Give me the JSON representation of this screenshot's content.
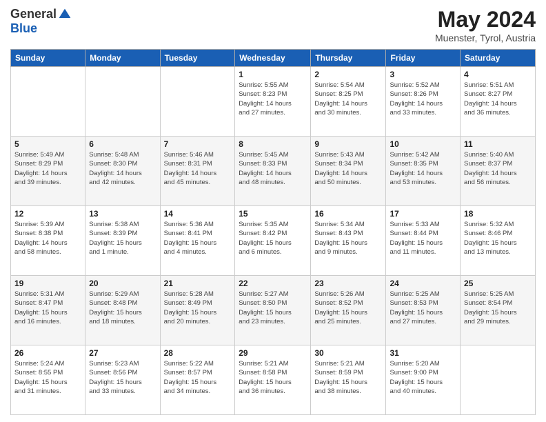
{
  "header": {
    "logo_general": "General",
    "logo_blue": "Blue",
    "month": "May 2024",
    "location": "Muenster, Tyrol, Austria"
  },
  "weekdays": [
    "Sunday",
    "Monday",
    "Tuesday",
    "Wednesday",
    "Thursday",
    "Friday",
    "Saturday"
  ],
  "weeks": [
    [
      {
        "day": "",
        "info": ""
      },
      {
        "day": "",
        "info": ""
      },
      {
        "day": "",
        "info": ""
      },
      {
        "day": "1",
        "info": "Sunrise: 5:55 AM\nSunset: 8:23 PM\nDaylight: 14 hours\nand 27 minutes."
      },
      {
        "day": "2",
        "info": "Sunrise: 5:54 AM\nSunset: 8:25 PM\nDaylight: 14 hours\nand 30 minutes."
      },
      {
        "day": "3",
        "info": "Sunrise: 5:52 AM\nSunset: 8:26 PM\nDaylight: 14 hours\nand 33 minutes."
      },
      {
        "day": "4",
        "info": "Sunrise: 5:51 AM\nSunset: 8:27 PM\nDaylight: 14 hours\nand 36 minutes."
      }
    ],
    [
      {
        "day": "5",
        "info": "Sunrise: 5:49 AM\nSunset: 8:29 PM\nDaylight: 14 hours\nand 39 minutes."
      },
      {
        "day": "6",
        "info": "Sunrise: 5:48 AM\nSunset: 8:30 PM\nDaylight: 14 hours\nand 42 minutes."
      },
      {
        "day": "7",
        "info": "Sunrise: 5:46 AM\nSunset: 8:31 PM\nDaylight: 14 hours\nand 45 minutes."
      },
      {
        "day": "8",
        "info": "Sunrise: 5:45 AM\nSunset: 8:33 PM\nDaylight: 14 hours\nand 48 minutes."
      },
      {
        "day": "9",
        "info": "Sunrise: 5:43 AM\nSunset: 8:34 PM\nDaylight: 14 hours\nand 50 minutes."
      },
      {
        "day": "10",
        "info": "Sunrise: 5:42 AM\nSunset: 8:35 PM\nDaylight: 14 hours\nand 53 minutes."
      },
      {
        "day": "11",
        "info": "Sunrise: 5:40 AM\nSunset: 8:37 PM\nDaylight: 14 hours\nand 56 minutes."
      }
    ],
    [
      {
        "day": "12",
        "info": "Sunrise: 5:39 AM\nSunset: 8:38 PM\nDaylight: 14 hours\nand 58 minutes."
      },
      {
        "day": "13",
        "info": "Sunrise: 5:38 AM\nSunset: 8:39 PM\nDaylight: 15 hours\nand 1 minute."
      },
      {
        "day": "14",
        "info": "Sunrise: 5:36 AM\nSunset: 8:41 PM\nDaylight: 15 hours\nand 4 minutes."
      },
      {
        "day": "15",
        "info": "Sunrise: 5:35 AM\nSunset: 8:42 PM\nDaylight: 15 hours\nand 6 minutes."
      },
      {
        "day": "16",
        "info": "Sunrise: 5:34 AM\nSunset: 8:43 PM\nDaylight: 15 hours\nand 9 minutes."
      },
      {
        "day": "17",
        "info": "Sunrise: 5:33 AM\nSunset: 8:44 PM\nDaylight: 15 hours\nand 11 minutes."
      },
      {
        "day": "18",
        "info": "Sunrise: 5:32 AM\nSunset: 8:46 PM\nDaylight: 15 hours\nand 13 minutes."
      }
    ],
    [
      {
        "day": "19",
        "info": "Sunrise: 5:31 AM\nSunset: 8:47 PM\nDaylight: 15 hours\nand 16 minutes."
      },
      {
        "day": "20",
        "info": "Sunrise: 5:29 AM\nSunset: 8:48 PM\nDaylight: 15 hours\nand 18 minutes."
      },
      {
        "day": "21",
        "info": "Sunrise: 5:28 AM\nSunset: 8:49 PM\nDaylight: 15 hours\nand 20 minutes."
      },
      {
        "day": "22",
        "info": "Sunrise: 5:27 AM\nSunset: 8:50 PM\nDaylight: 15 hours\nand 23 minutes."
      },
      {
        "day": "23",
        "info": "Sunrise: 5:26 AM\nSunset: 8:52 PM\nDaylight: 15 hours\nand 25 minutes."
      },
      {
        "day": "24",
        "info": "Sunrise: 5:25 AM\nSunset: 8:53 PM\nDaylight: 15 hours\nand 27 minutes."
      },
      {
        "day": "25",
        "info": "Sunrise: 5:25 AM\nSunset: 8:54 PM\nDaylight: 15 hours\nand 29 minutes."
      }
    ],
    [
      {
        "day": "26",
        "info": "Sunrise: 5:24 AM\nSunset: 8:55 PM\nDaylight: 15 hours\nand 31 minutes."
      },
      {
        "day": "27",
        "info": "Sunrise: 5:23 AM\nSunset: 8:56 PM\nDaylight: 15 hours\nand 33 minutes."
      },
      {
        "day": "28",
        "info": "Sunrise: 5:22 AM\nSunset: 8:57 PM\nDaylight: 15 hours\nand 34 minutes."
      },
      {
        "day": "29",
        "info": "Sunrise: 5:21 AM\nSunset: 8:58 PM\nDaylight: 15 hours\nand 36 minutes."
      },
      {
        "day": "30",
        "info": "Sunrise: 5:21 AM\nSunset: 8:59 PM\nDaylight: 15 hours\nand 38 minutes."
      },
      {
        "day": "31",
        "info": "Sunrise: 5:20 AM\nSunset: 9:00 PM\nDaylight: 15 hours\nand 40 minutes."
      },
      {
        "day": "",
        "info": ""
      }
    ]
  ]
}
